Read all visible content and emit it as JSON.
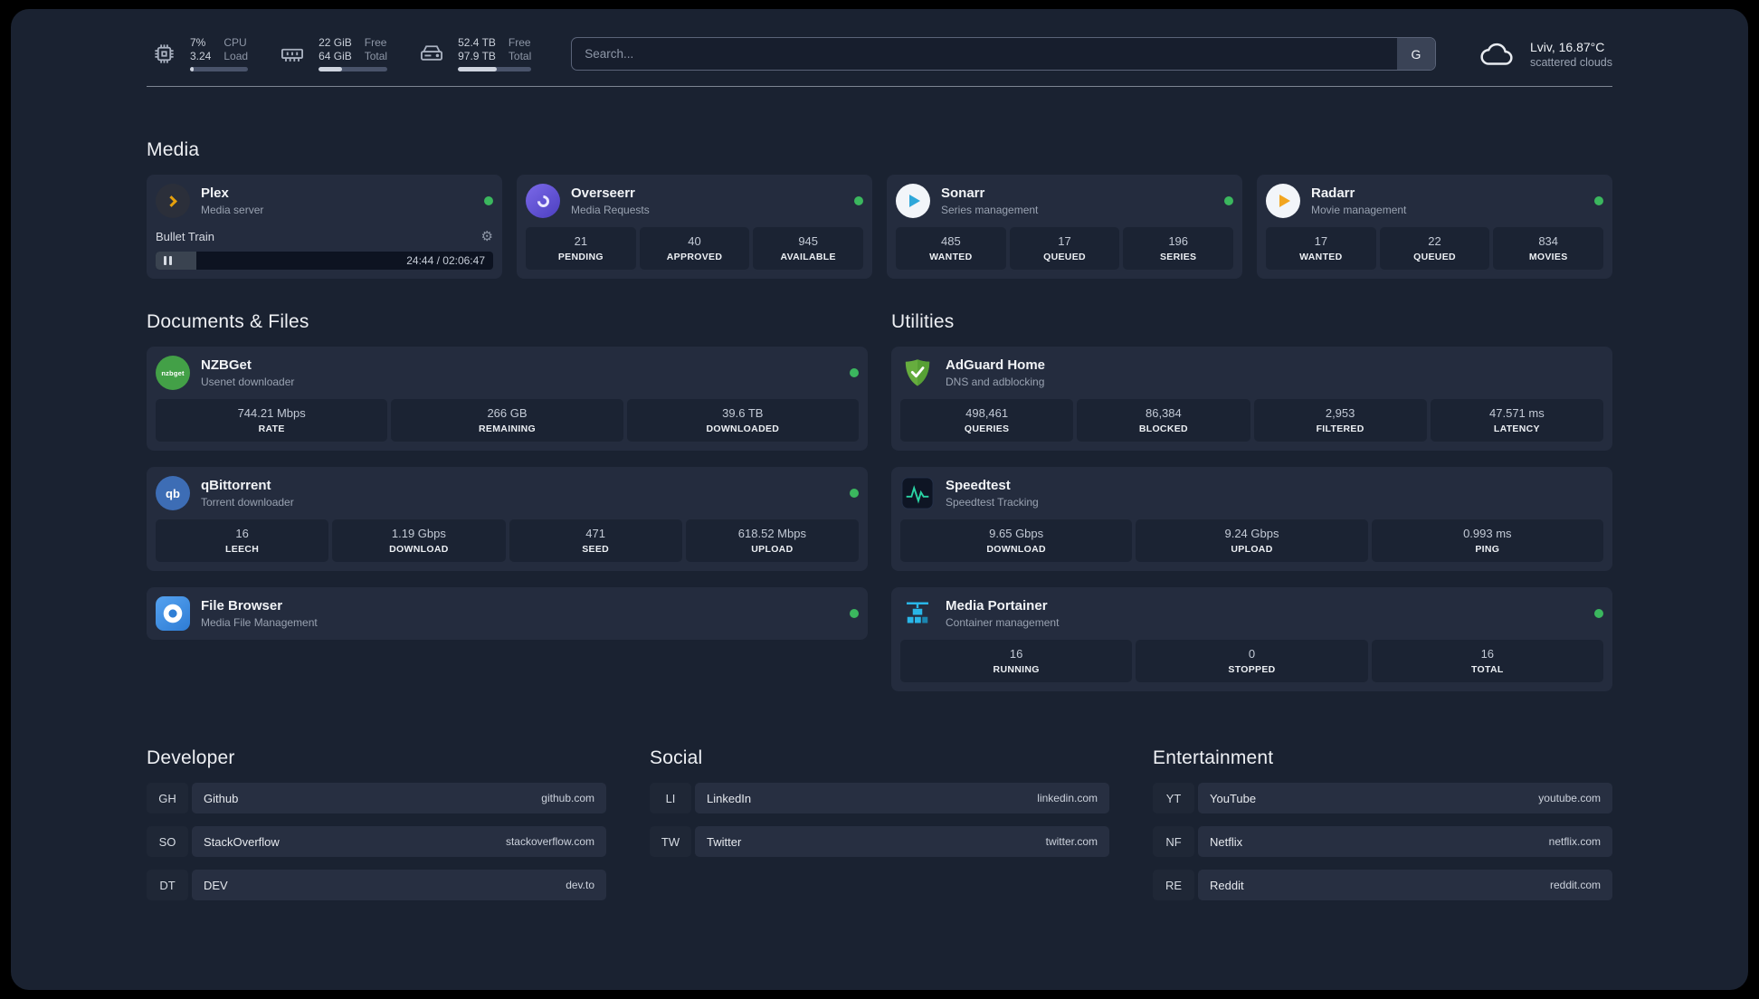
{
  "topbar": {
    "cpu": {
      "top_value": "7%",
      "bottom_value": "3.24",
      "top_label": "CPU",
      "bottom_label": "Load",
      "percent": 7
    },
    "memory": {
      "top_value": "22 GiB",
      "bottom_value": "64 GiB",
      "top_label": "Free",
      "bottom_label": "Total",
      "percent": 34
    },
    "disk": {
      "top_value": "52.4 TB",
      "bottom_value": "97.9 TB",
      "top_label": "Free",
      "bottom_label": "Total",
      "percent": 53
    },
    "search": {
      "placeholder": "Search...",
      "button": "G"
    },
    "weather": {
      "location": "Lviv, 16.87°C",
      "condition": "scattered clouds"
    }
  },
  "colors": {
    "status_green": "#3bb75e"
  },
  "sections": {
    "media": {
      "title": "Media",
      "plex": {
        "name": "Plex",
        "sub": "Media server",
        "now_playing": "Bullet Train",
        "time": "24:44 / 02:06:47",
        "progress_percent": 12,
        "gear": "⚙"
      },
      "overseerr": {
        "name": "Overseerr",
        "sub": "Media Requests",
        "stats": [
          {
            "value": "21",
            "label": "PENDING"
          },
          {
            "value": "40",
            "label": "APPROVED"
          },
          {
            "value": "945",
            "label": "AVAILABLE"
          }
        ]
      },
      "sonarr": {
        "name": "Sonarr",
        "sub": "Series management",
        "stats": [
          {
            "value": "485",
            "label": "WANTED"
          },
          {
            "value": "17",
            "label": "QUEUED"
          },
          {
            "value": "196",
            "label": "SERIES"
          }
        ]
      },
      "radarr": {
        "name": "Radarr",
        "sub": "Movie management",
        "stats": [
          {
            "value": "17",
            "label": "WANTED"
          },
          {
            "value": "22",
            "label": "QUEUED"
          },
          {
            "value": "834",
            "label": "MOVIES"
          }
        ]
      }
    },
    "documents": {
      "title": "Documents & Files",
      "nzbget": {
        "name": "NZBGet",
        "sub": "Usenet downloader",
        "stats": [
          {
            "value": "744.21 Mbps",
            "label": "RATE"
          },
          {
            "value": "266 GB",
            "label": "REMAINING"
          },
          {
            "value": "39.6 TB",
            "label": "DOWNLOADED"
          }
        ]
      },
      "qbittorrent": {
        "name": "qBittorrent",
        "sub": "Torrent downloader",
        "stats": [
          {
            "value": "16",
            "label": "LEECH"
          },
          {
            "value": "1.19 Gbps",
            "label": "DOWNLOAD"
          },
          {
            "value": "471",
            "label": "SEED"
          },
          {
            "value": "618.52 Mbps",
            "label": "UPLOAD"
          }
        ]
      },
      "filebrowser": {
        "name": "File Browser",
        "sub": "Media File Management"
      }
    },
    "utilities": {
      "title": "Utilities",
      "adguard": {
        "name": "AdGuard Home",
        "sub": "DNS and adblocking",
        "stats": [
          {
            "value": "498,461",
            "label": "QUERIES"
          },
          {
            "value": "86,384",
            "label": "BLOCKED"
          },
          {
            "value": "2,953",
            "label": "FILTERED"
          },
          {
            "value": "47.571 ms",
            "label": "LATENCY"
          }
        ]
      },
      "speedtest": {
        "name": "Speedtest",
        "sub": "Speedtest Tracking",
        "stats": [
          {
            "value": "9.65 Gbps",
            "label": "DOWNLOAD"
          },
          {
            "value": "9.24 Gbps",
            "label": "UPLOAD"
          },
          {
            "value": "0.993 ms",
            "label": "PING"
          }
        ]
      },
      "portainer": {
        "name": "Media Portainer",
        "sub": "Container management",
        "stats": [
          {
            "value": "16",
            "label": "RUNNING"
          },
          {
            "value": "0",
            "label": "STOPPED"
          },
          {
            "value": "16",
            "label": "TOTAL"
          }
        ]
      }
    },
    "bookmarks": [
      {
        "title": "Developer",
        "links": [
          {
            "abbr": "GH",
            "name": "Github",
            "url": "github.com"
          },
          {
            "abbr": "SO",
            "name": "StackOverflow",
            "url": "stackoverflow.com"
          },
          {
            "abbr": "DT",
            "name": "DEV",
            "url": "dev.to"
          }
        ]
      },
      {
        "title": "Social",
        "links": [
          {
            "abbr": "LI",
            "name": "LinkedIn",
            "url": "linkedin.com"
          },
          {
            "abbr": "TW",
            "name": "Twitter",
            "url": "twitter.com"
          }
        ]
      },
      {
        "title": "Entertainment",
        "links": [
          {
            "abbr": "YT",
            "name": "YouTube",
            "url": "youtube.com"
          },
          {
            "abbr": "NF",
            "name": "Netflix",
            "url": "netflix.com"
          },
          {
            "abbr": "RE",
            "name": "Reddit",
            "url": "reddit.com"
          }
        ]
      }
    ]
  },
  "icons": {
    "nzbget_text": "nzbget",
    "qb_text": "qb"
  }
}
